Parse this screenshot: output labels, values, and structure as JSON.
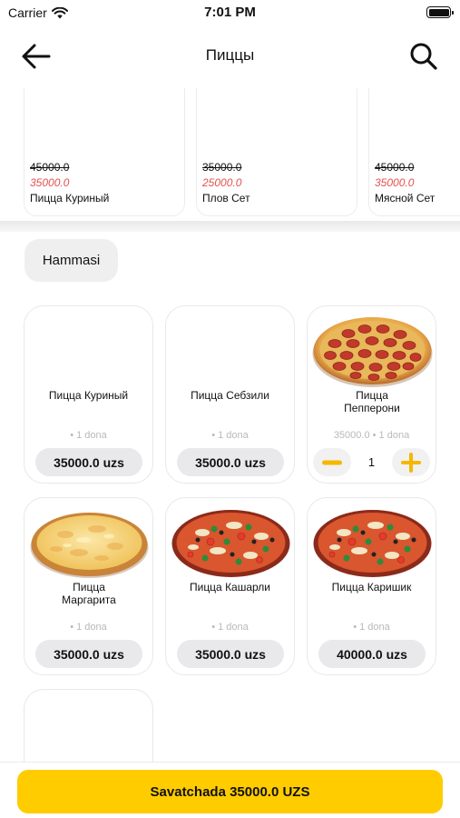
{
  "status_bar": {
    "carrier": "Carrier",
    "time": "7:01 PM"
  },
  "header": {
    "title": "Пиццы",
    "back_icon": "arrow-left-icon",
    "search_icon": "search-icon"
  },
  "featured": [
    {
      "old_price": "45000.0",
      "new_price": "35000.0",
      "name": "Пицца Куриный"
    },
    {
      "old_price": "35000.0",
      "new_price": "25000.0",
      "name": "Плов Сет"
    },
    {
      "old_price": "45000.0",
      "new_price": "35000.0",
      "name": "Мясной Сет"
    }
  ],
  "category_chip": "Hammasi",
  "products": [
    {
      "name": "Пицца Куриный",
      "unit": "• 1 dona",
      "price": "35000.0 uzs",
      "image": "none"
    },
    {
      "name": "Пицца Себзили",
      "unit": "• 1 dona",
      "price": "35000.0 uzs",
      "image": "none"
    },
    {
      "name": "Пицца Пепперони",
      "unit": "35000.0  • 1 dona",
      "quantity": "1",
      "image": "pepperoni-pizza"
    },
    {
      "name": "Пицца Маргарита",
      "unit": "• 1 dona",
      "price": "35000.0 uzs",
      "image": "cheese-pizza"
    },
    {
      "name": "Пицца Кашарли",
      "unit": "• 1 dona",
      "price": "35000.0 uzs",
      "image": "vegetable-pizza"
    },
    {
      "name": "Пицца Каришик",
      "unit": "• 1 dona",
      "price": "40000.0 uzs",
      "image": "vegetable-pizza"
    }
  ],
  "cart_button": "Savatchada 35000.0 UZS",
  "colors": {
    "accent": "#ffcc00",
    "sale_price": "#e4514f",
    "pill": "#e9e9eb"
  }
}
